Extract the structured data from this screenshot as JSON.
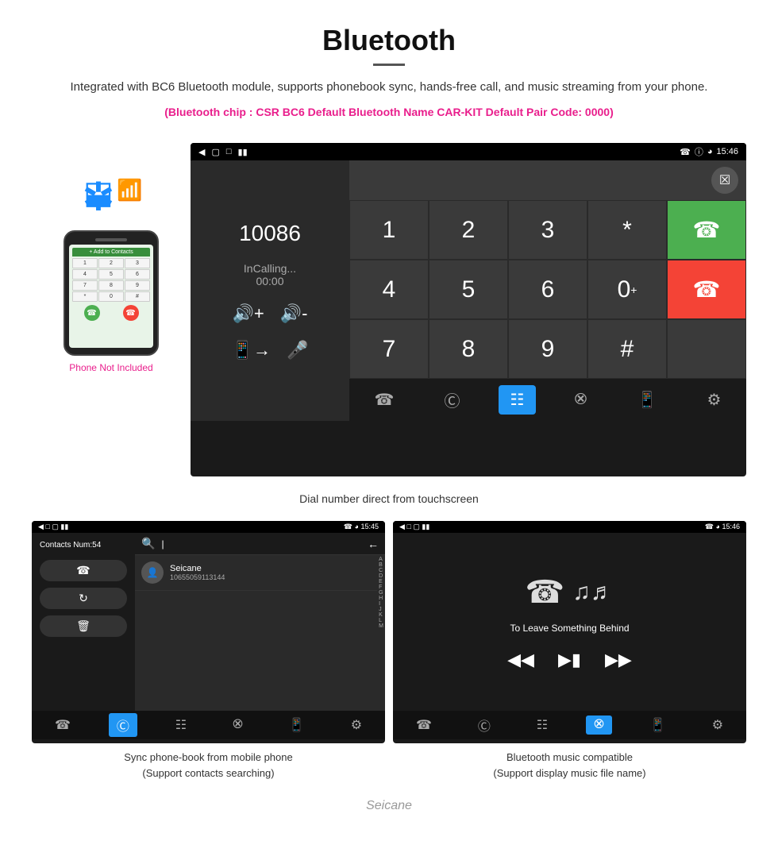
{
  "header": {
    "title": "Bluetooth",
    "description": "Integrated with BC6 Bluetooth module, supports phonebook sync, hands-free call, and music streaming from your phone.",
    "specs": "(Bluetooth chip : CSR BC6    Default Bluetooth Name CAR-KIT    Default Pair Code: 0000)"
  },
  "phone_left": {
    "not_included": "Phone Not Included"
  },
  "dialer_screen": {
    "status_time": "15:46",
    "number": "10086",
    "calling_label": "InCalling...",
    "timer": "00:00",
    "keys": [
      "1",
      "2",
      "3",
      "*",
      "4",
      "5",
      "6",
      "0+",
      "7",
      "8",
      "9",
      "#"
    ]
  },
  "dialer_caption": "Dial number direct from touchscreen",
  "contacts_screen": {
    "status_time": "15:45",
    "contacts_num_label": "Contacts Num:54",
    "contact_name": "Seicane",
    "contact_number": "10655059113144",
    "alphabet": [
      "A",
      "B",
      "C",
      "D",
      "E",
      "F",
      "G",
      "H",
      "I",
      "J",
      "K",
      "L",
      "M"
    ]
  },
  "music_screen": {
    "status_time": "15:46",
    "song_title": "To Leave Something Behind"
  },
  "captions": {
    "contacts_caption": "Sync phone-book from mobile phone",
    "contacts_sub": "(Support contacts searching)",
    "music_caption": "Bluetooth music compatible",
    "music_sub": "(Support display music file name)"
  },
  "watermark": "Seicane"
}
